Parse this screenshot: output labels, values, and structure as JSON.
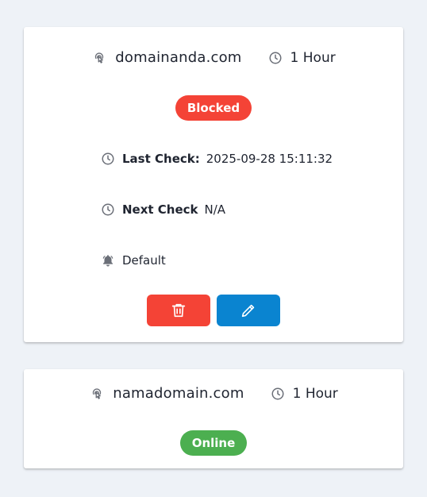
{
  "cards": [
    {
      "domain": "domainanda.com",
      "interval": "1 Hour",
      "status": "Blocked",
      "last_check_label": "Last Check:",
      "last_check_value": "2025-09-28 15:11:32",
      "next_check_label": "Next Check",
      "next_check_value": "N/A",
      "notification": "Default"
    },
    {
      "domain": "namadomain.com",
      "interval": "1 Hour",
      "status": "Online"
    }
  ],
  "colors": {
    "blocked": "#f44336",
    "online": "#4caf50",
    "delete_button": "#f44336",
    "edit_button": "#0a84d0"
  },
  "icons": {
    "domain": "touch-pointer-icon",
    "interval": "clock-icon",
    "notification": "bell-icon",
    "delete": "trash-icon",
    "edit": "pencil-icon"
  }
}
